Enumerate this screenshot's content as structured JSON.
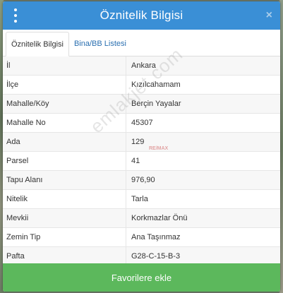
{
  "dialog": {
    "title": "Öznitelik Bilgisi",
    "close_glyph": "×",
    "favorite_label": "Favorilere ekle"
  },
  "tabs": [
    {
      "label": "Öznitelik Bilgisi",
      "active": true
    },
    {
      "label": "Bina/BB Listesi",
      "active": false
    }
  ],
  "attributes": [
    {
      "key": "İl",
      "value": "Ankara"
    },
    {
      "key": "İlçe",
      "value": "Kızılcahamam"
    },
    {
      "key": "Mahalle/Köy",
      "value": "Berçin Yayalar"
    },
    {
      "key": "Mahalle No",
      "value": "45307"
    },
    {
      "key": "Ada",
      "value": "129"
    },
    {
      "key": "Parsel",
      "value": "41"
    },
    {
      "key": "Tapu Alanı",
      "value": "976,90"
    },
    {
      "key": "Nitelik",
      "value": "Tarla"
    },
    {
      "key": "Mevkii",
      "value": "Korkmazlar Önü"
    },
    {
      "key": "Zemin Tip",
      "value": "Ana Taşınmaz"
    },
    {
      "key": "Pafta",
      "value": "G28-C-15-B-3"
    }
  ],
  "watermark": {
    "text": "emlakjet.com",
    "badge": "RE/MAX"
  },
  "colors": {
    "header": "#3a8fd6",
    "favorite_button": "#5cb85c",
    "tab_link": "#2a6fb0"
  },
  "icons": {
    "menu": "vertical-dots-menu-icon",
    "close": "close-icon"
  }
}
